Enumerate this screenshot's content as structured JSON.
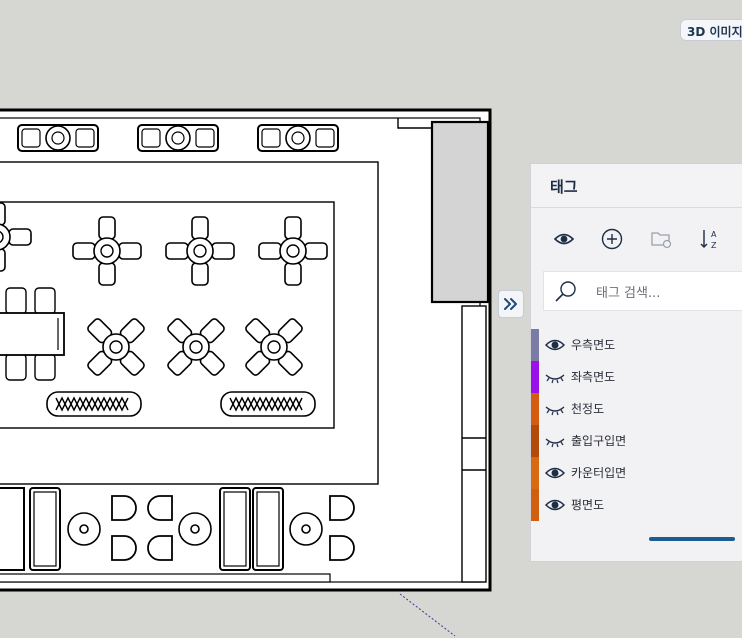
{
  "badge": {
    "label": "3D 이미지"
  },
  "tag_panel": {
    "title": "태그",
    "toolbar": {
      "visibility": "eye-icon",
      "add": "add-circle-icon",
      "add_folder": "folder-add-icon",
      "sort": "sort-az-icon"
    },
    "search": {
      "placeholder": "태그 검색..."
    },
    "tags": [
      {
        "label": "우측면도",
        "color": "#7b7ca5",
        "visible": true
      },
      {
        "label": "좌측면도",
        "color": "#9a10e8",
        "visible": false
      },
      {
        "label": "천정도",
        "color": "#d35c10",
        "visible": false
      },
      {
        "label": "출입구입면",
        "color": "#b34a0a",
        "visible": false
      },
      {
        "label": "카운터입면",
        "color": "#d86a12",
        "visible": true
      },
      {
        "label": "평면도",
        "color": "#d25e10",
        "visible": true
      }
    ],
    "accent_color": "#1e5b8e"
  }
}
